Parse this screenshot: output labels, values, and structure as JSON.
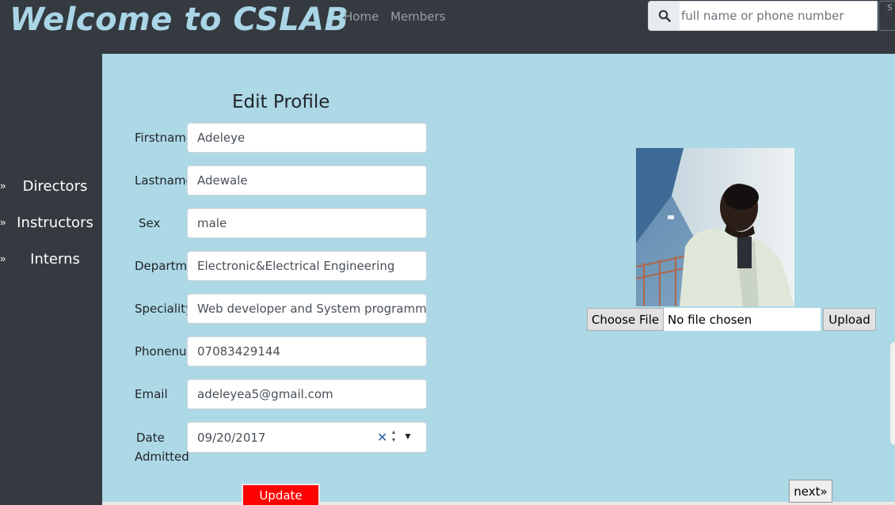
{
  "navbar": {
    "brand": "Welcome to CSLAB",
    "links": [
      "Home",
      "Members"
    ],
    "search": {
      "icon": "search-icon",
      "placeholder": "full name or phone number",
      "submit_label": "s"
    }
  },
  "sidebar": {
    "items": [
      {
        "label": "Directors",
        "icon": "chevron-right-icon"
      },
      {
        "label": "Instructors",
        "icon": "chevron-right-icon"
      },
      {
        "label": "Interns",
        "icon": "chevron-right-icon"
      }
    ]
  },
  "form": {
    "title": "Edit Profile",
    "fields": [
      {
        "label": "Firstname",
        "value": "Adeleye"
      },
      {
        "label": "Lastname",
        "value": "Adewale"
      },
      {
        "label": "Sex",
        "value": "male"
      },
      {
        "label": "Department",
        "value": "Electronic&Electrical Engineering"
      },
      {
        "label": "Speciality",
        "value": "Web developer and System programmer"
      },
      {
        "label": "Phonenumber",
        "value": "07083429144"
      },
      {
        "label": "Email",
        "value": "adeleyea5@gmail.com"
      }
    ],
    "date_admitted": {
      "label_line1": "Date",
      "label_line2": "Admitted",
      "value": "09/20/2017"
    },
    "update_label": "Update"
  },
  "photo": {
    "choose_label": "Choose File",
    "file_status": "No file chosen",
    "upload_label": "Upload"
  },
  "pager": {
    "next_label": "next»"
  },
  "colors": {
    "navbar_bg": "#343a40",
    "brand": "#a9d5e6",
    "main_bg": "#add8e6",
    "update_button": "#ff0000"
  }
}
